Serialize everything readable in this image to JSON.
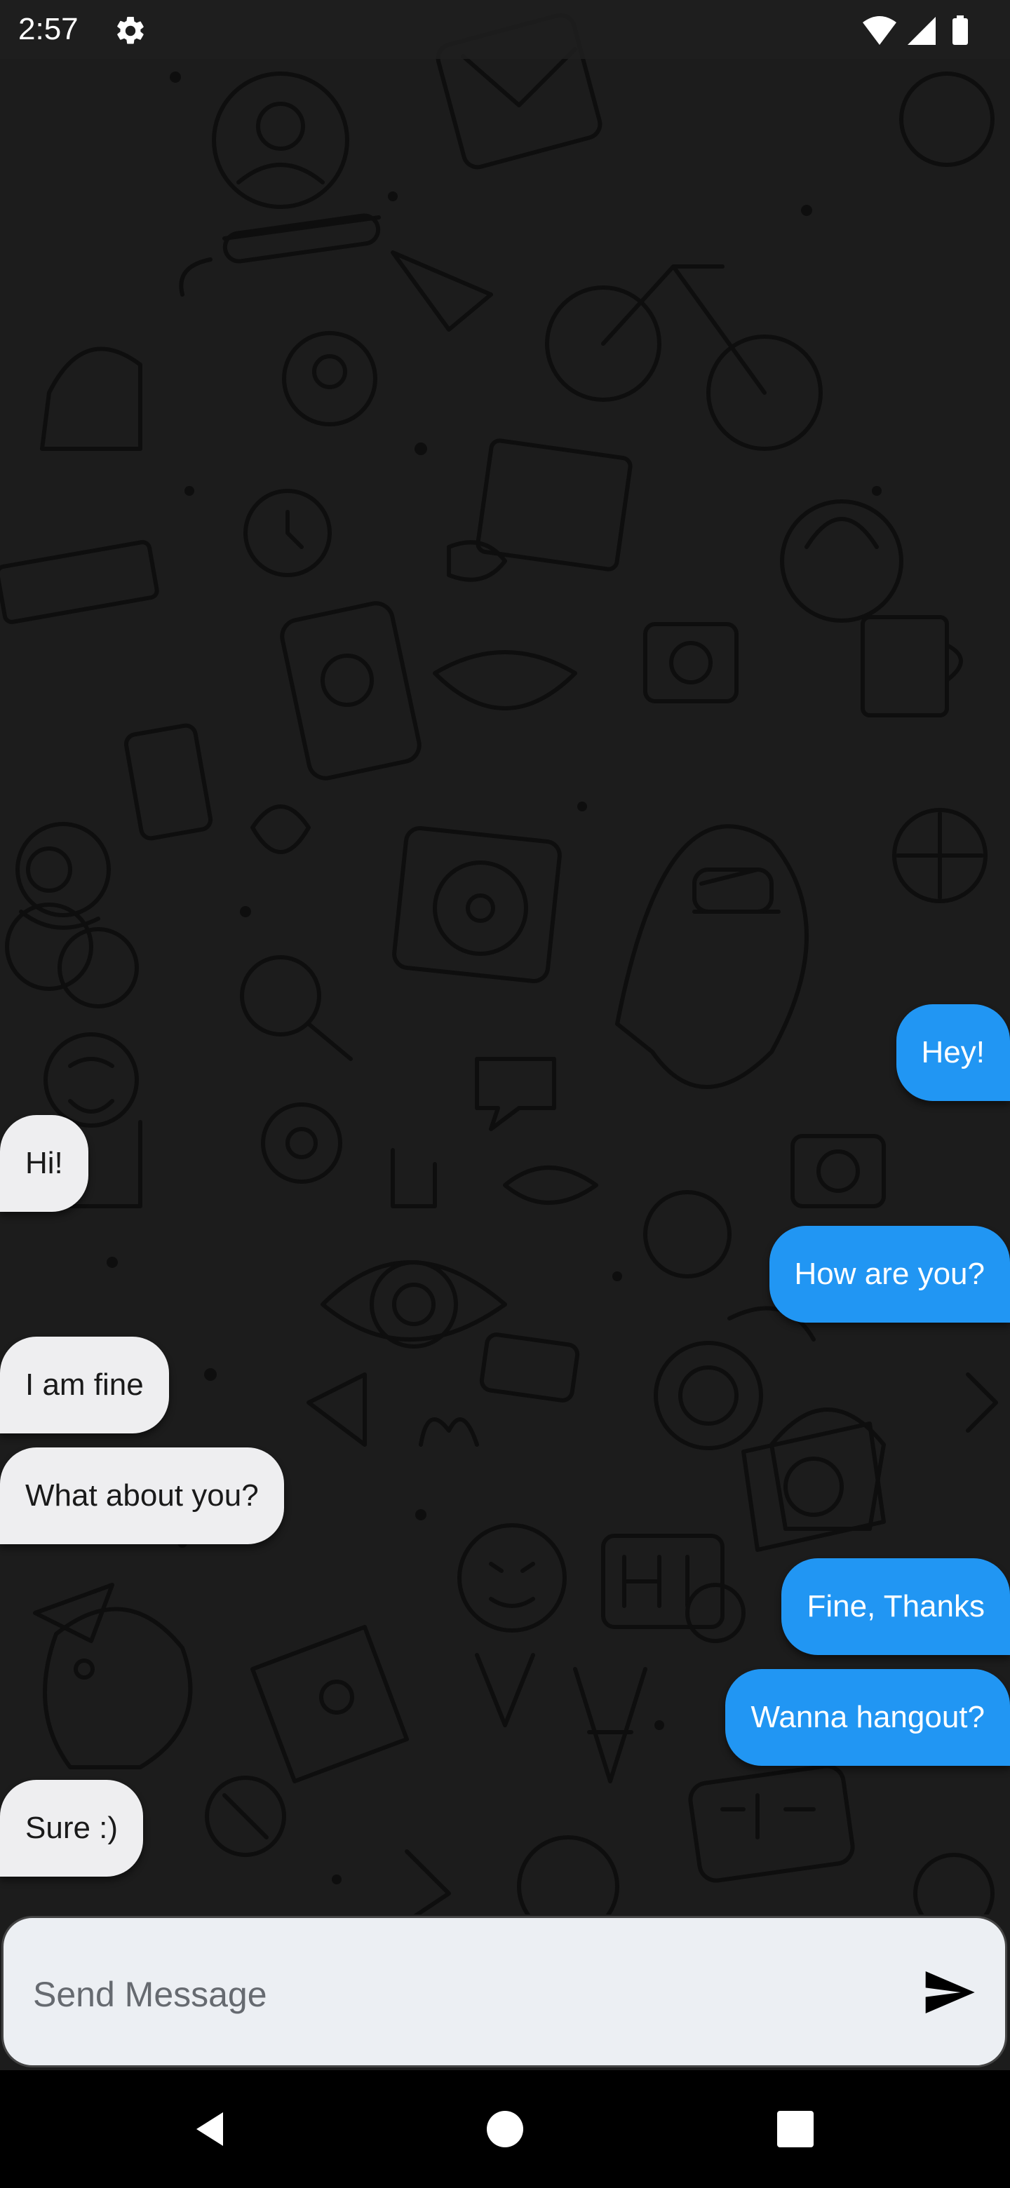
{
  "status_bar": {
    "time": "2:57",
    "icons": [
      "gear-icon",
      "wifi-icon",
      "cellular-signal-icon",
      "battery-icon"
    ]
  },
  "messages": [
    {
      "side": "me",
      "text": "Hey!"
    },
    {
      "side": "them",
      "text": "Hi!"
    },
    {
      "side": "me",
      "text": "How are you?"
    },
    {
      "side": "them",
      "text": "I am fine"
    },
    {
      "side": "them",
      "text": "What about you?"
    },
    {
      "side": "me",
      "text": "Fine, Thanks"
    },
    {
      "side": "me",
      "text": "Wanna hangout?"
    },
    {
      "side": "them",
      "text": "Sure :)"
    }
  ],
  "composer": {
    "placeholder": "Send Message",
    "value": "",
    "send_icon": "send-icon"
  },
  "nav_bar": {
    "icons": [
      "back-icon",
      "home-icon",
      "recents-icon"
    ]
  },
  "colors": {
    "outgoing_bubble": "#2196f3",
    "incoming_bubble": "#eeeef0",
    "background": "#1b1b1b"
  }
}
